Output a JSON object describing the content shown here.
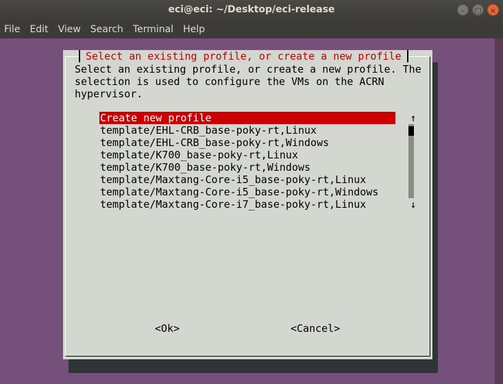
{
  "window": {
    "title": "eci@eci: ~/Desktop/eci-release",
    "buttons": {
      "minimize": "–",
      "maximize": "□",
      "close": "×"
    }
  },
  "menubar": {
    "items": [
      "File",
      "Edit",
      "View",
      "Search",
      "Terminal",
      "Help"
    ]
  },
  "dialog": {
    "title": "Select an existing profile, or create a new profile",
    "description_lines": [
      "Select an existing profile, or create a new profile. The",
      "selection is used to configure the VMs on the ACRN",
      "hypervisor."
    ],
    "list": [
      "Create new profile",
      "template/EHL-CRB_base-poky-rt,Linux",
      "template/EHL-CRB_base-poky-rt,Windows",
      "template/K700_base-poky-rt,Linux",
      "template/K700_base-poky-rt,Windows",
      "template/Maxtang-Core-i5_base-poky-rt,Linux",
      "template/Maxtang-Core-i5_base-poky-rt,Windows",
      "template/Maxtang-Core-i7_base-poky-rt,Linux"
    ],
    "selected_index": 0,
    "scroll_up": "↑",
    "scroll_down": "↓",
    "ok_label": "<Ok>",
    "cancel_label": "<Cancel>"
  },
  "colors": {
    "terminal_bg": "#75507b",
    "dialog_bg": "#d3d7cf",
    "accent": "#cc0000"
  }
}
